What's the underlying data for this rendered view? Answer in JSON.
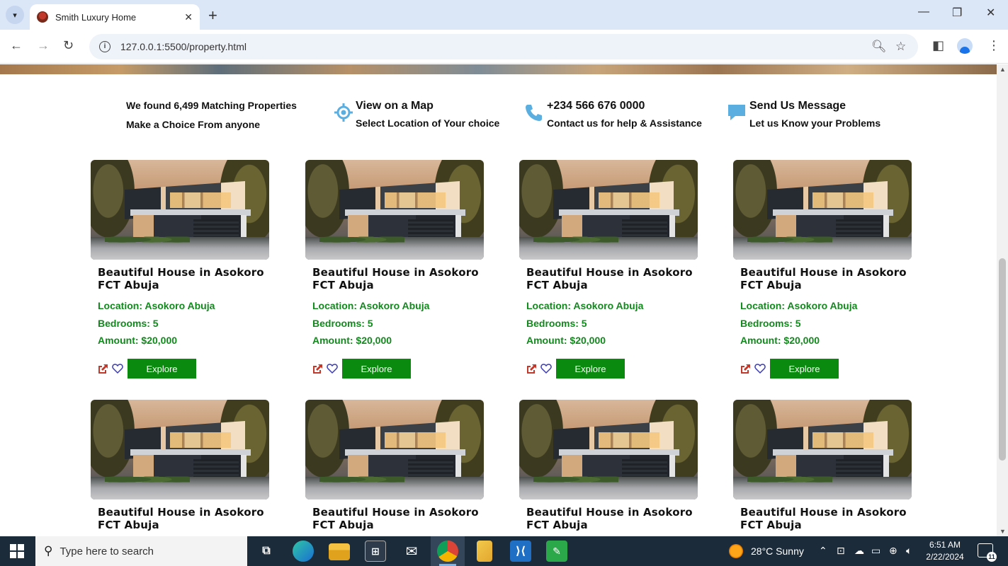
{
  "browser": {
    "tab_title": "Smith Luxury Home",
    "url": "127.0.0.1:5500/property.html"
  },
  "info": {
    "found_line1": "We found 6,499 Matching Properties",
    "found_line2": "Make a Choice From anyone",
    "map_title": "View on a Map",
    "map_sub": "Select Location of Your choice",
    "phone_title": "+234 566 676 0000",
    "phone_sub": "Contact us for help & Assistance",
    "msg_title": "Send Us Message",
    "msg_sub": "Let us Know your Problems"
  },
  "cards": [
    {
      "title": "Beautiful House in Asokoro FCT Abuja",
      "location": "Location: Asokoro Abuja",
      "bedrooms": "Bedrooms: 5",
      "amount": "Amount: $20,000",
      "button": "Explore"
    },
    {
      "title": "Beautiful House in Asokoro FCT Abuja",
      "location": "Location: Asokoro Abuja",
      "bedrooms": "Bedrooms: 5",
      "amount": "Amount: $20,000",
      "button": "Explore"
    },
    {
      "title": "Beautiful House in Asokoro FCT Abuja",
      "location": "Location: Asokoro Abuja",
      "bedrooms": "Bedrooms: 5",
      "amount": "Amount: $20,000",
      "button": "Explore"
    },
    {
      "title": "Beautiful House in Asokoro FCT Abuja",
      "location": "Location: Asokoro Abuja",
      "bedrooms": "Bedrooms: 5",
      "amount": "Amount: $20,000",
      "button": "Explore"
    },
    {
      "title": "Beautiful House in Asokoro FCT Abuja"
    },
    {
      "title": "Beautiful House in Asokoro FCT Abuja"
    },
    {
      "title": "Beautiful House in Asokoro FCT Abuja"
    },
    {
      "title": "Beautiful House in Asokoro FCT Abuja"
    }
  ],
  "taskbar": {
    "search_placeholder": "Type here to search",
    "weather": "28°C  Sunny",
    "time": "6:51 AM",
    "date": "2/22/2024",
    "notification_count": "11"
  },
  "colors": {
    "accent_green": "#118a1c",
    "button_green": "#0a8a0e",
    "icon_blue": "#5aaee0",
    "share_red": "#c0392b",
    "heart_blue": "#3b3bb5"
  }
}
